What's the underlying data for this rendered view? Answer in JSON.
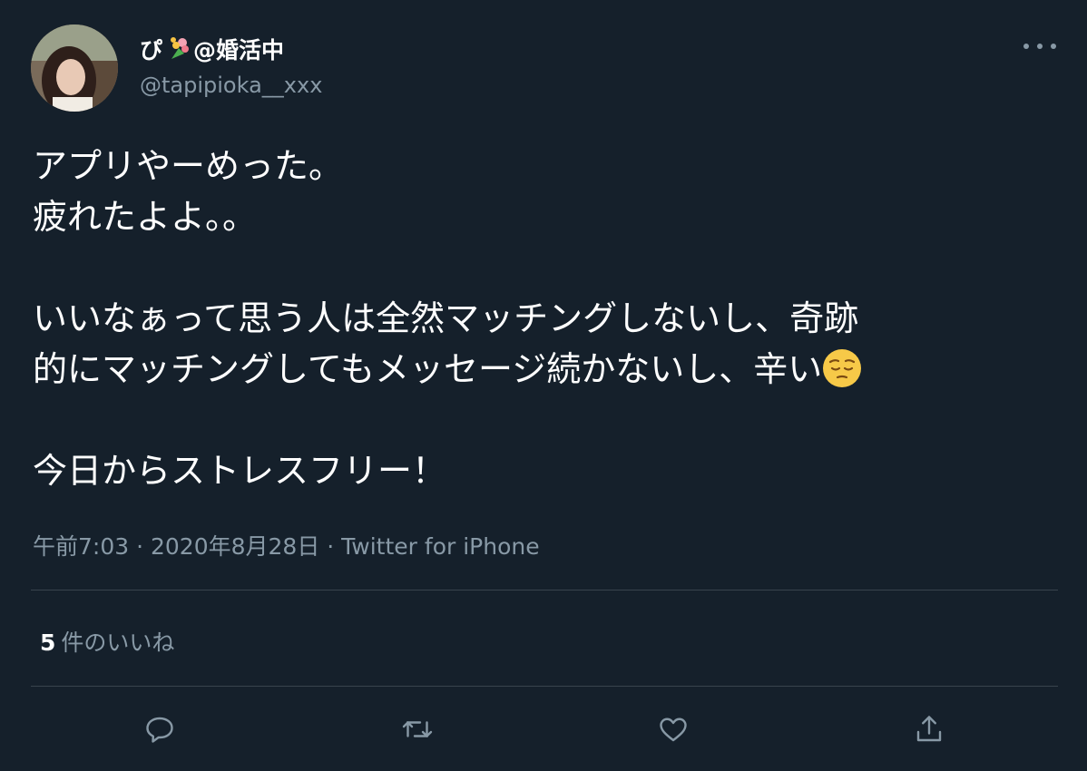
{
  "tweet": {
    "display_name_prefix": "ぴ",
    "display_name_suffix": "@婚活中",
    "name_emoji_icon": "bouquet-icon",
    "handle": "@tapipioka__xxx",
    "text": {
      "line1": "アプリやーめった。",
      "line2": "疲れたよよ。。",
      "line3": "いいなぁって思う人は全然マッチングしないし、奇跡",
      "line4": "的にマッチングしてもメッセージ続かないし、辛い",
      "line4_emoji_icon": "pensive-face-icon",
      "line5": "今日からストレスフリー！"
    },
    "meta": "午前7:03 · 2020年8月28日 · Twitter for iPhone",
    "likes_count": "5",
    "likes_label": "件のいいね"
  },
  "actions": [
    {
      "icon": "reply-icon"
    },
    {
      "icon": "retweet-icon"
    },
    {
      "icon": "like-icon"
    },
    {
      "icon": "share-icon"
    }
  ],
  "colors": {
    "background": "#15202b",
    "text_primary": "#ffffff",
    "text_secondary": "#8899a6",
    "divider": "#38444d"
  }
}
